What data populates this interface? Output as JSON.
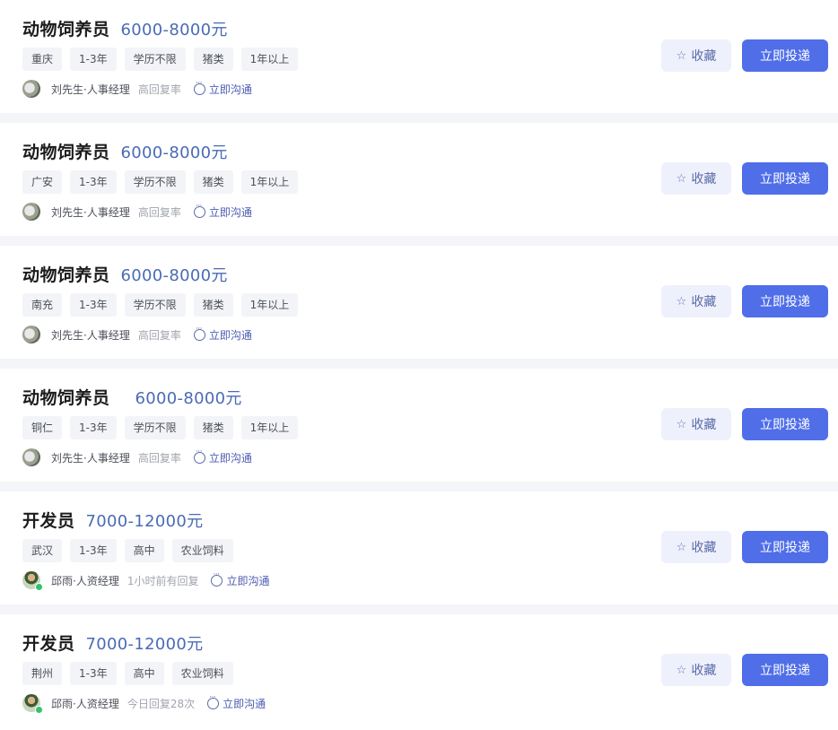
{
  "jobs": [
    {
      "title": "动物饲养员",
      "salary": "6000-8000元",
      "tags": [
        "重庆",
        "1-3年",
        "学历不限",
        "猪类",
        "1年以上"
      ],
      "recruiter": "刘先生·人事经理",
      "reply": "高回复率",
      "chat_label": "立即沟通",
      "favorite_label": "收藏",
      "apply_label": "立即投递"
    },
    {
      "title": "动物饲养员",
      "salary": "6000-8000元",
      "tags": [
        "广安",
        "1-3年",
        "学历不限",
        "猪类",
        "1年以上"
      ],
      "recruiter": "刘先生·人事经理",
      "reply": "高回复率",
      "chat_label": "立即沟通",
      "favorite_label": "收藏",
      "apply_label": "立即投递"
    },
    {
      "title": "动物饲养员",
      "salary": "6000-8000元",
      "tags": [
        "南充",
        "1-3年",
        "学历不限",
        "猪类",
        "1年以上"
      ],
      "recruiter": "刘先生·人事经理",
      "reply": "高回复率",
      "chat_label": "立即沟通",
      "favorite_label": "收藏",
      "apply_label": "立即投递"
    },
    {
      "title": "动物饲养员",
      "salary": "6000-8000元",
      "tags": [
        "铜仁",
        "1-3年",
        "学历不限",
        "猪类",
        "1年以上"
      ],
      "recruiter": "刘先生·人事经理",
      "reply": "高回复率",
      "chat_label": "立即沟通",
      "favorite_label": "收藏",
      "apply_label": "立即投递"
    },
    {
      "title": "开发员",
      "salary": "7000-12000元",
      "tags": [
        "武汉",
        "1-3年",
        "高中",
        "农业饲料"
      ],
      "recruiter": "邱雨·人资经理",
      "reply": "1小时前有回复",
      "chat_label": "立即沟通",
      "favorite_label": "收藏",
      "apply_label": "立即投递"
    },
    {
      "title": "开发员",
      "salary": "7000-12000元",
      "tags": [
        "荆州",
        "1-3年",
        "高中",
        "农业饲料"
      ],
      "recruiter": "邱雨·人资经理",
      "reply": "今日回复28次",
      "chat_label": "立即沟通",
      "favorite_label": "收藏",
      "apply_label": "立即投递"
    }
  ],
  "icons": {
    "favorite": "star-outline-icon",
    "chat": "chat-bubble-icon",
    "online": "online-status-dot"
  },
  "colors": {
    "salary": "#4a6bb5",
    "apply_button": "#4f6ee8",
    "favorite_button_bg": "#eef1fb",
    "chat_link": "#4b5bb0",
    "online_dot": "#2fc46c"
  }
}
